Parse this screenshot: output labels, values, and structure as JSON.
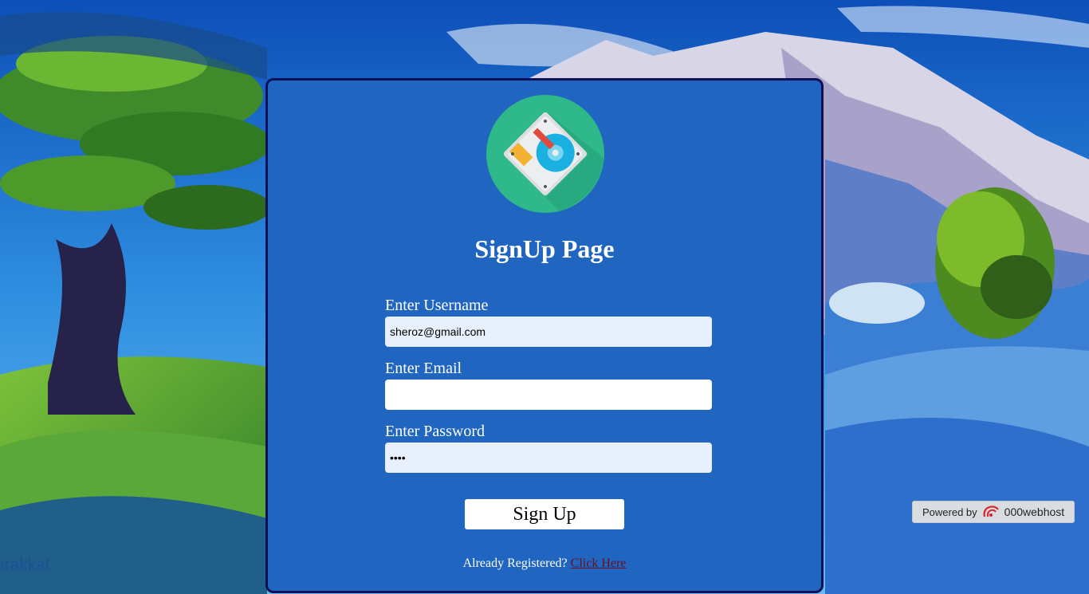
{
  "page": {
    "title": "SignUp Page"
  },
  "form": {
    "username_label": "Enter Username",
    "username_value": "sheroz@gmail.com",
    "email_label": "Enter Email",
    "email_value": "",
    "password_label": "Enter Password",
    "password_value": "••••",
    "submit_label": "Sign Up"
  },
  "footer": {
    "prompt": "Already Registered?",
    "link": "Click Here"
  },
  "badge": {
    "prefix": "Powered by",
    "brand": "000webhost"
  },
  "background": {
    "artist_watermark": "arakkal"
  },
  "colors": {
    "card": "#2066c1",
    "card_border": "#0d0f57",
    "autofill": "#e8f0fe",
    "link": "#6b1020"
  },
  "icons": {
    "logo": "hard-drive-icon"
  }
}
